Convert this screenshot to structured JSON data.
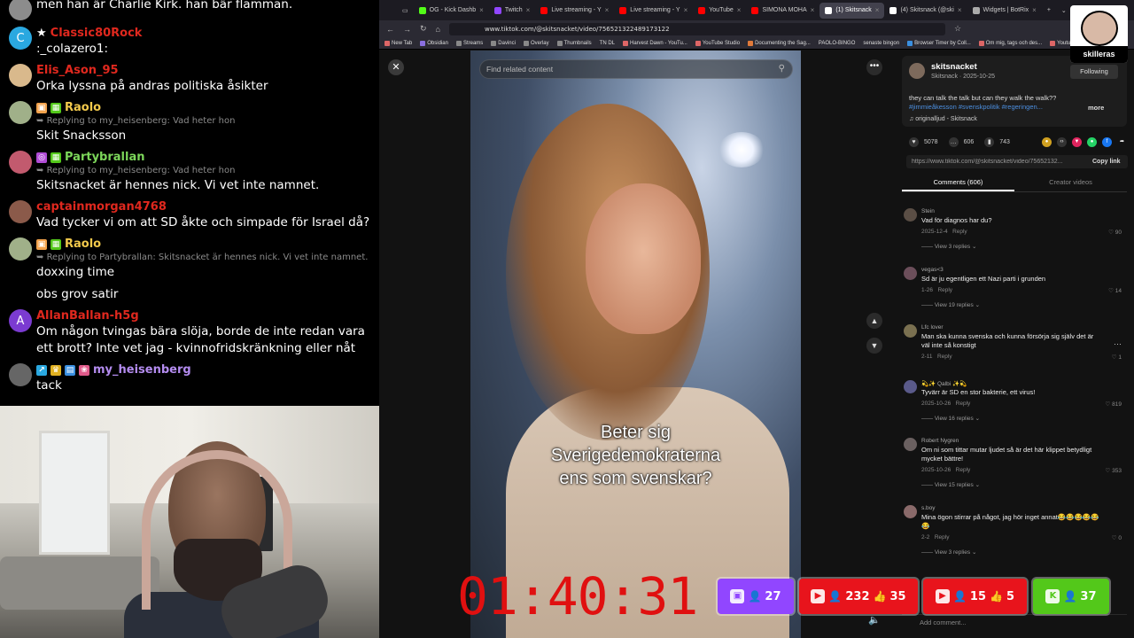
{
  "chat": {
    "messages": [
      {
        "user": "",
        "text": "men han är Charlie Kirk. han bär flamman.",
        "avatar": "image",
        "avatar_color": "#8c8c8c"
      },
      {
        "user": "Classic80Rock",
        "user_color": "#e0281e",
        "star": "★",
        "text": ":_colazero1:",
        "avatar": "C",
        "avatar_color": "#2aa8e0"
      },
      {
        "user": "Elis_Ason_95",
        "user_color": "#e0281e",
        "text": "Orka lyssna på andras politiska åsikter",
        "avatar": "image",
        "avatar_color": "#d9b98c"
      },
      {
        "user": "Raolo",
        "user_color": "#f2c94c",
        "reply": "Replying to my_heisenberg: Vad heter hon",
        "text": "Skit Snacksson",
        "avatar": "image",
        "avatar_color": "#a0b089"
      },
      {
        "user": "Partybrallan",
        "user_color": "#7cd65a",
        "reply": "Replying to my_heisenberg: Vad heter hon",
        "text": "Skitsnacket är hennes nick. Vi vet inte namnet.",
        "avatar": "image",
        "avatar_color": "#c25a6e"
      },
      {
        "user": "captainmorgan4768",
        "user_color": "#e0281e",
        "text": "Vad tycker vi om att SD åkte och simpade för Israel då?",
        "avatar": "image",
        "avatar_color": "#8b5a4a"
      },
      {
        "user": "Raolo",
        "user_color": "#f2c94c",
        "reply": "Replying to Partybrallan: Skitsnacket är hennes nick. Vi vet inte namnet.",
        "text": "doxxing time",
        "text2": "obs grov satir",
        "avatar": "image",
        "avatar_color": "#a0b089"
      },
      {
        "user": "AllanBallan-h5g",
        "user_color": "#e0281e",
        "text": "Om någon tvingas bära slöja, borde de inte redan vara ett brott? Inte vet jag - kvinnofridskränkning eller nåt",
        "avatar": "A",
        "avatar_color": "#7b3bd1"
      },
      {
        "user": "my_heisenberg",
        "user_color": "#b48cf0",
        "text": "tack",
        "avatar": "image",
        "avatar_color": "#666"
      }
    ]
  },
  "browser": {
    "tabs": [
      {
        "label": "OG - Kick Dashb",
        "fav": "#53fc18",
        "active": false
      },
      {
        "label": "Twitch",
        "fav": "#9146ff",
        "active": false
      },
      {
        "label": "Live streaming - Y",
        "fav": "#ff0000",
        "active": false
      },
      {
        "label": "Live streaming - Y",
        "fav": "#ff0000",
        "active": false
      },
      {
        "label": "YouTube",
        "fav": "#ff0000",
        "active": false
      },
      {
        "label": "SIMONA MOHA",
        "fav": "#ff0000",
        "active": false
      },
      {
        "label": "(1) Skitsnack",
        "fav": "#ffffff",
        "active": true
      },
      {
        "label": "(4) Skitsnack (@ski",
        "fav": "#ffffff",
        "active": false
      },
      {
        "label": "Widgets | BotRix",
        "fav": "#aaaaaa",
        "active": false
      }
    ],
    "url": "www.tiktok.com/@skitsnacket/video/756521322489173122",
    "bookmarks": [
      "New Tab",
      "Obsidian",
      "Streams",
      "Davinci",
      "Overlay",
      "Thumbnails",
      "TN DL",
      "Harvest Dawn - YouTu...",
      "YouTube Studio",
      "Documenting the Sag...",
      "PAOLO-BINGO",
      "senaste bingon",
      "Browser Timer by Coll...",
      "Om mig, tags och des...",
      "Youtube"
    ]
  },
  "video": {
    "search_placeholder": "Find related content",
    "caption": [
      "Beter sig",
      "Sverigedemokraterna",
      "ens som svenskar?"
    ],
    "timer": "01:40:31"
  },
  "post": {
    "author": "skitsnacket",
    "subline": "Skitsnack · 2025-10-25",
    "follow": "Following",
    "description": "they can talk the talk but can they walk the walk??",
    "tags": "#jimmieåkesson #svenskpolitik #regeringen...",
    "more": "more",
    "sound": "originalljud - Skitsnack",
    "likes": "5078",
    "comments": "606",
    "saves": "743",
    "link": "https://www.tiktok.com/@skitsnacket/video/75652132...",
    "copy": "Copy link",
    "tab_comments": "Comments (606)",
    "tab_creator": "Creator videos",
    "comment_placeholder": "Add comment..."
  },
  "comments": [
    {
      "name": "Stein",
      "text": "Vad för diagnos har du?",
      "date": "2025-12-4",
      "reply": "Reply",
      "likes": "90",
      "replies": "View 3 replies"
    },
    {
      "name": "vegas<3",
      "text": "Sd är ju egentligen ett Nazi parti i grunden",
      "date": "1-26",
      "reply": "Reply",
      "likes": "14",
      "replies": "View 19 replies"
    },
    {
      "name": "Lfc lover",
      "text": "Man ska kunna svenska och kunna försörja sig själv det är väl inte så konstigt",
      "date": "2-11",
      "reply": "Reply",
      "likes": "1",
      "replies": ""
    },
    {
      "name": "💫✨ Qalbi ✨💫",
      "text": "Tyvärr är SD en stor bakterie, ett virus!",
      "date": "2025-10-26",
      "reply": "Reply",
      "likes": "819",
      "replies": "View 16 replies"
    },
    {
      "name": "Robert Nygren",
      "text": "Om ni som tittar mutar ljudet så är det här klippet betydligt mycket bättre!",
      "date": "2025-10-26",
      "reply": "Reply",
      "likes": "353",
      "replies": "View 15 replies"
    },
    {
      "name": "s.boy",
      "text": "Mina ögon stirrar på något, jag hör inget annat😂😂😂😂😂😂",
      "date": "2-2",
      "reply": "Reply",
      "likes": "0",
      "replies": "View 3 replies"
    }
  ],
  "overlay": {
    "twitch": {
      "viewers": "27",
      "color": "#9146ff"
    },
    "youtube1": {
      "viewers": "232",
      "likes": "35",
      "color": "#e8141c"
    },
    "youtube2": {
      "viewers": "15",
      "likes": "5",
      "color": "#e8141c"
    },
    "kick": {
      "viewers": "37",
      "color": "#53c81a"
    }
  },
  "logo": {
    "label": "skilleras"
  }
}
